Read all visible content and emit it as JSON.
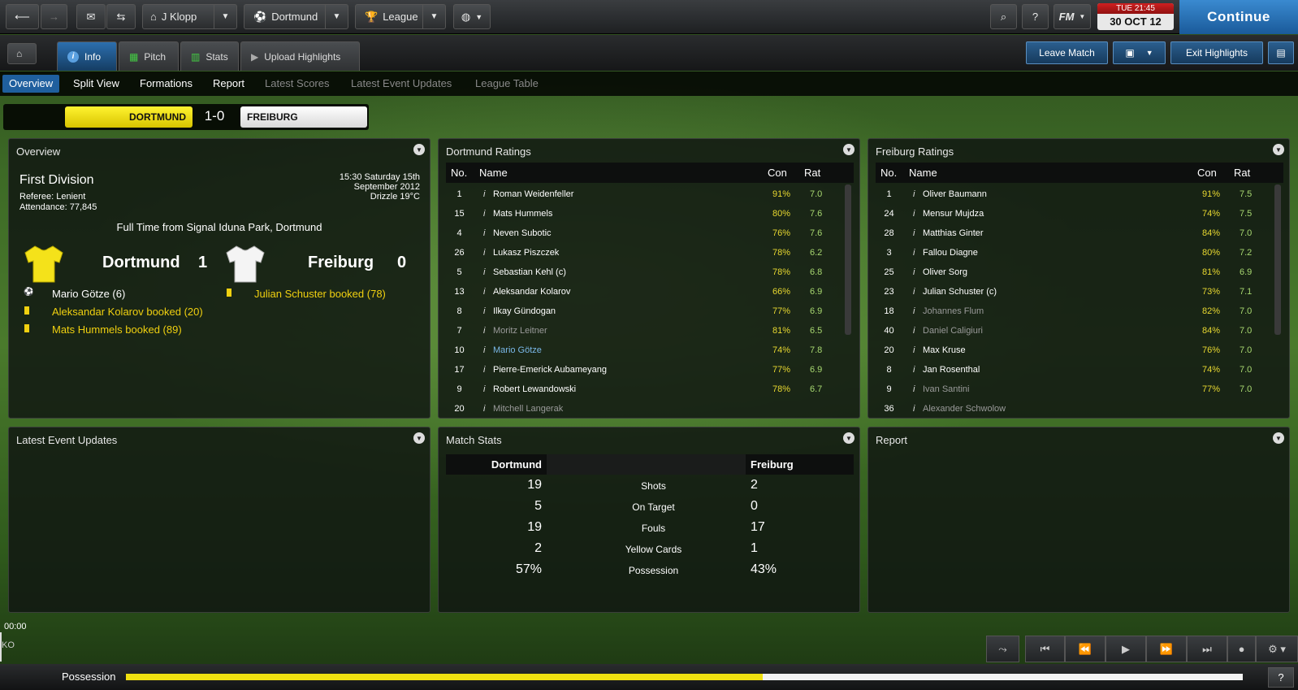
{
  "topbar": {
    "manager": "J Klopp",
    "club": "Dortmund",
    "competition": "League",
    "date_time": "TUE 21:45",
    "date": "30 OCT 12",
    "continue": "Continue",
    "help": "?",
    "fm": "FM"
  },
  "tabs": [
    {
      "label": "Info"
    },
    {
      "label": "Pitch"
    },
    {
      "label": "Stats"
    },
    {
      "label": "Upload Highlights"
    }
  ],
  "buttons": {
    "leave_match": "Leave Match",
    "exit_highlights": "Exit Highlights"
  },
  "subnav": [
    "Overview",
    "Split View",
    "Formations",
    "Report",
    "Latest Scores",
    "Latest Event Updates",
    "League Table"
  ],
  "score": {
    "home": "DORTMUND",
    "result": "1-0",
    "away": "FREIBURG"
  },
  "overview": {
    "title": "Overview",
    "competition": "First Division",
    "referee": "Referee: Lenient",
    "attendance": "Attendance: 77,845",
    "kickoff": "15:30 Saturday 15th",
    "kickoff2": "September 2012",
    "weather": "Drizzle 19°C",
    "fulltime": "Full Time from Signal Iduna Park, Dortmund",
    "home": "Dortmund",
    "home_goals": "1",
    "away": "Freiburg",
    "away_goals": "0",
    "home_events": [
      "Mario Götze (6)",
      "Aleksandar Kolarov booked (20)",
      "Mats Hummels booked (89)"
    ],
    "away_events": [
      "Julian Schuster booked (78)"
    ]
  },
  "ratings_headers": {
    "no": "No.",
    "name": "Name",
    "con": "Con",
    "rat": "Rat"
  },
  "dortmund_ratings": {
    "title": "Dortmund Ratings",
    "rows": [
      [
        "1",
        "Roman Weidenfeller",
        "91%",
        "7.0"
      ],
      [
        "15",
        "Mats Hummels",
        "80%",
        "7.6"
      ],
      [
        "4",
        "Neven Subotic",
        "76%",
        "7.6"
      ],
      [
        "26",
        "Lukasz Piszczek",
        "78%",
        "6.2"
      ],
      [
        "5",
        "Sebastian Kehl (c)",
        "78%",
        "6.8"
      ],
      [
        "13",
        "Aleksandar Kolarov",
        "66%",
        "6.9"
      ],
      [
        "8",
        "Ilkay Gündogan",
        "77%",
        "6.9"
      ],
      [
        "7",
        "Moritz Leitner",
        "81%",
        "6.5"
      ],
      [
        "10",
        "Mario Götze",
        "74%",
        "7.8"
      ],
      [
        "17",
        "Pierre-Emerick Aubameyang",
        "77%",
        "6.9"
      ],
      [
        "9",
        "Robert Lewandowski",
        "78%",
        "6.7"
      ],
      [
        "20",
        "Mitchell Langerak",
        "",
        ""
      ]
    ]
  },
  "freiburg_ratings": {
    "title": "Freiburg Ratings",
    "rows": [
      [
        "1",
        "Oliver Baumann",
        "91%",
        "7.5"
      ],
      [
        "24",
        "Mensur Mujdza",
        "74%",
        "7.5"
      ],
      [
        "28",
        "Matthias Ginter",
        "84%",
        "7.0"
      ],
      [
        "3",
        "Fallou Diagne",
        "80%",
        "7.2"
      ],
      [
        "25",
        "Oliver Sorg",
        "81%",
        "6.9"
      ],
      [
        "23",
        "Julian Schuster (c)",
        "73%",
        "7.1"
      ],
      [
        "18",
        "Johannes Flum",
        "82%",
        "7.0"
      ],
      [
        "40",
        "Daniel Caligiuri",
        "84%",
        "7.0"
      ],
      [
        "20",
        "Max Kruse",
        "76%",
        "7.0"
      ],
      [
        "8",
        "Jan Rosenthal",
        "74%",
        "7.0"
      ],
      [
        "9",
        "Ivan Santini",
        "77%",
        "7.0"
      ],
      [
        "36",
        "Alexander Schwolow",
        "",
        ""
      ]
    ]
  },
  "latest_events": {
    "title": "Latest Event Updates"
  },
  "match_stats": {
    "title": "Match Stats",
    "home": "Dortmund",
    "away": "Freiburg",
    "rows": [
      [
        "19",
        "Shots",
        "2"
      ],
      [
        "5",
        "On Target",
        "0"
      ],
      [
        "19",
        "Fouls",
        "17"
      ],
      [
        "2",
        "Yellow Cards",
        "1"
      ],
      [
        "57%",
        "Possession",
        "43%"
      ]
    ]
  },
  "report": {
    "title": "Report"
  },
  "timeline": {
    "time": "00:00",
    "ko": "KO"
  },
  "possession": {
    "label": "Possession",
    "home_share": 0.57
  },
  "colors": {
    "home": "#f0e010",
    "away": "#ffffff",
    "accent": "#1f5f9e"
  }
}
